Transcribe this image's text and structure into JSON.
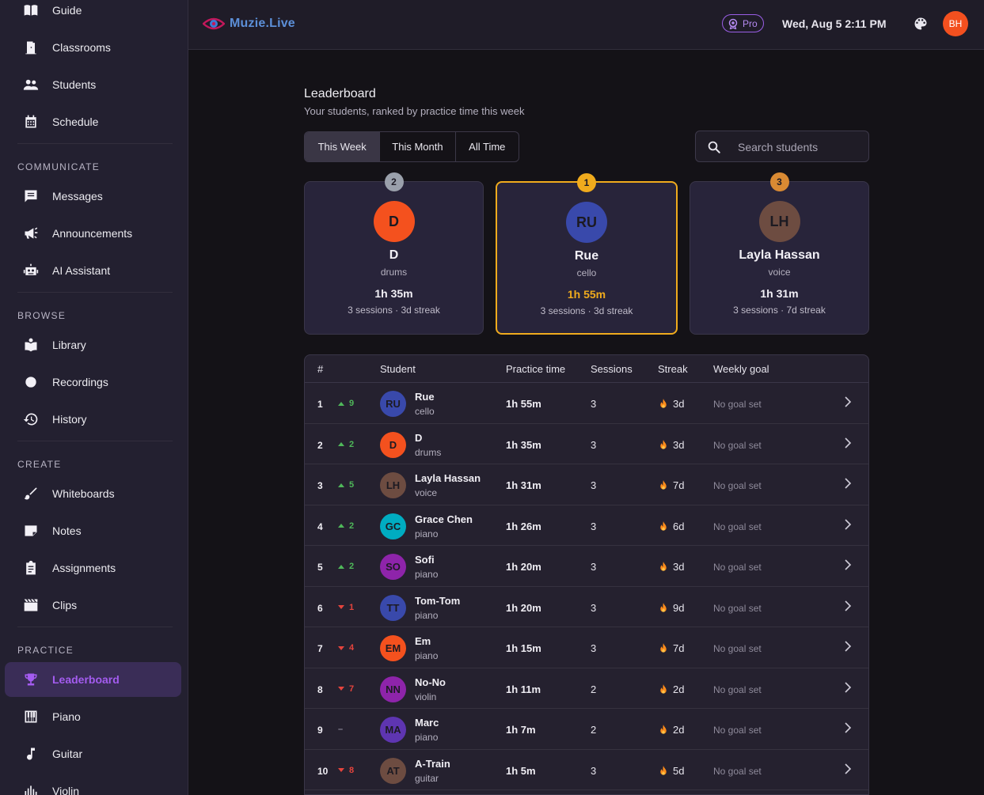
{
  "sidebar": {
    "items_top": [
      {
        "label": "Guide",
        "icon": "book-open-icon"
      },
      {
        "label": "Classrooms",
        "icon": "door-icon"
      },
      {
        "label": "Students",
        "icon": "people-icon"
      },
      {
        "label": "Schedule",
        "icon": "calendar-icon"
      }
    ],
    "sections": [
      {
        "title": "COMMUNICATE",
        "items": [
          {
            "label": "Messages",
            "icon": "chat-icon"
          },
          {
            "label": "Announcements",
            "icon": "megaphone-icon"
          },
          {
            "label": "AI Assistant",
            "icon": "robot-icon"
          }
        ]
      },
      {
        "title": "BROWSE",
        "items": [
          {
            "label": "Library",
            "icon": "library-icon"
          },
          {
            "label": "Recordings",
            "icon": "record-icon"
          },
          {
            "label": "History",
            "icon": "history-icon"
          }
        ]
      },
      {
        "title": "CREATE",
        "items": [
          {
            "label": "Whiteboards",
            "icon": "brush-icon"
          },
          {
            "label": "Notes",
            "icon": "note-icon"
          },
          {
            "label": "Assignments",
            "icon": "clipboard-icon"
          },
          {
            "label": "Clips",
            "icon": "clapperboard-icon"
          }
        ]
      },
      {
        "title": "PRACTICE",
        "items": [
          {
            "label": "Leaderboard",
            "icon": "trophy-icon",
            "active": true
          },
          {
            "label": "Piano",
            "icon": "piano-icon"
          },
          {
            "label": "Guitar",
            "icon": "music-note-icon"
          },
          {
            "label": "Violin",
            "icon": "equalizer-icon"
          }
        ]
      }
    ]
  },
  "header": {
    "brand": "Muzie.Live",
    "pro_label": "Pro",
    "datetime": "Wed, Aug 5 2:11 PM",
    "avatar_initials": "BH",
    "avatar_color": "#f3501f"
  },
  "page": {
    "title": "Leaderboard",
    "subtitle": "Your students, ranked by practice time this week",
    "tabs": [
      "This Week",
      "This Month",
      "All Time"
    ],
    "active_tab": "This Week",
    "search_placeholder": "Search students"
  },
  "podium": [
    {
      "rank": "2",
      "initials": "D",
      "name": "D",
      "instrument": "drums",
      "time": "1h 35m",
      "meta": "3 sessions · 3d streak",
      "avatar_color": "#f4511e",
      "badge_color": "#9aa0ab"
    },
    {
      "rank": "1",
      "initials": "RU",
      "name": "Rue",
      "instrument": "cello",
      "time": "1h 55m",
      "meta": "3 sessions · 3d streak",
      "avatar_color": "#3949ab",
      "badge_color": "#f0ab1d",
      "highlight": "#f0ab1d"
    },
    {
      "rank": "3",
      "initials": "LH",
      "name": "Layla Hassan",
      "instrument": "voice",
      "time": "1h 31m",
      "meta": "3 sessions · 7d streak",
      "avatar_color": "#6d4c41",
      "badge_color": "#d98a33"
    }
  ],
  "table": {
    "headers": [
      "#",
      "Student",
      "Practice time",
      "Sessions",
      "Streak",
      "Weekly goal"
    ],
    "rows": [
      {
        "rank": "1",
        "move": "9",
        "dir": "up",
        "initials": "RU",
        "name": "Rue",
        "instrument": "cello",
        "time": "1h 55m",
        "sessions": "3",
        "streak": "3d",
        "goal": "No goal set",
        "color": "#3949ab"
      },
      {
        "rank": "2",
        "move": "2",
        "dir": "up",
        "initials": "D",
        "name": "D",
        "instrument": "drums",
        "time": "1h 35m",
        "sessions": "3",
        "streak": "3d",
        "goal": "No goal set",
        "color": "#f4511e"
      },
      {
        "rank": "3",
        "move": "5",
        "dir": "up",
        "initials": "LH",
        "name": "Layla Hassan",
        "instrument": "voice",
        "time": "1h 31m",
        "sessions": "3",
        "streak": "7d",
        "goal": "No goal set",
        "color": "#6d4c41"
      },
      {
        "rank": "4",
        "move": "2",
        "dir": "up",
        "initials": "GC",
        "name": "Grace Chen",
        "instrument": "piano",
        "time": "1h 26m",
        "sessions": "3",
        "streak": "6d",
        "goal": "No goal set",
        "color": "#00acc1"
      },
      {
        "rank": "5",
        "move": "2",
        "dir": "up",
        "initials": "SO",
        "name": "Sofi",
        "instrument": "piano",
        "time": "1h 20m",
        "sessions": "3",
        "streak": "3d",
        "goal": "No goal set",
        "color": "#8e24aa"
      },
      {
        "rank": "6",
        "move": "1",
        "dir": "down",
        "initials": "TT",
        "name": "Tom-Tom",
        "instrument": "piano",
        "time": "1h 20m",
        "sessions": "3",
        "streak": "9d",
        "goal": "No goal set",
        "color": "#3949ab"
      },
      {
        "rank": "7",
        "move": "4",
        "dir": "down",
        "initials": "EM",
        "name": "Em",
        "instrument": "piano",
        "time": "1h 15m",
        "sessions": "3",
        "streak": "7d",
        "goal": "No goal set",
        "color": "#f4511e"
      },
      {
        "rank": "8",
        "move": "7",
        "dir": "down",
        "initials": "NN",
        "name": "No-No",
        "instrument": "violin",
        "time": "1h 11m",
        "sessions": "2",
        "streak": "2d",
        "goal": "No goal set",
        "color": "#8e24aa"
      },
      {
        "rank": "9",
        "move": "–",
        "dir": "flat",
        "initials": "MA",
        "name": "Marc",
        "instrument": "piano",
        "time": "1h 7m",
        "sessions": "2",
        "streak": "2d",
        "goal": "No goal set",
        "color": "#5e35b1"
      },
      {
        "rank": "10",
        "move": "8",
        "dir": "down",
        "initials": "AT",
        "name": "A-Train",
        "instrument": "guitar",
        "time": "1h 5m",
        "sessions": "3",
        "streak": "5d",
        "goal": "No goal set",
        "color": "#6d4c41"
      }
    ]
  }
}
